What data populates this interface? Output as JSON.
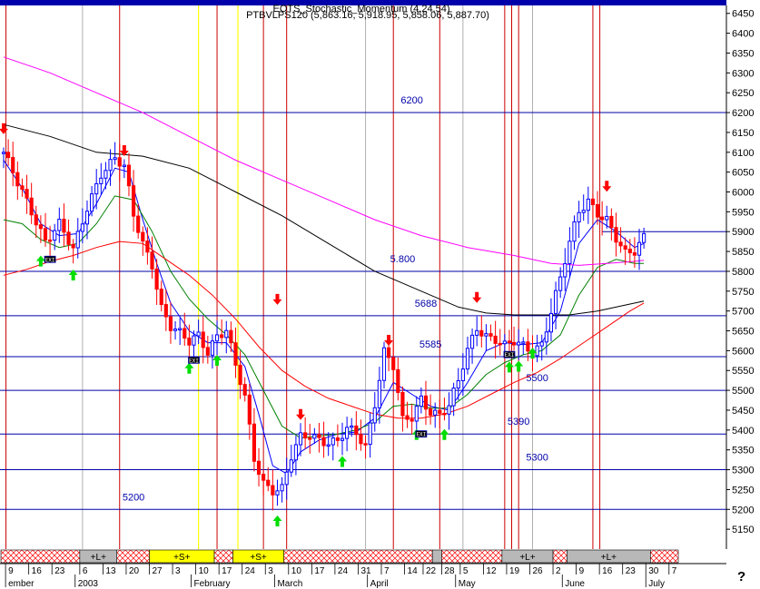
{
  "header": {
    "line1": "EOTS_Stochastic_Momentum (4,24,54)",
    "line2": "PTBVLPS120 (5,863.16, 5,918.95, 5,858.06, 5,887.70)"
  },
  "corner_mark": "?",
  "chart_data": {
    "type": "candlestick",
    "ylim": [
      5100,
      6470
    ],
    "yticks": [
      5150,
      5200,
      5250,
      5300,
      5350,
      5400,
      5450,
      5500,
      5550,
      5600,
      5650,
      5700,
      5750,
      5800,
      5850,
      5900,
      5950,
      6000,
      6050,
      6100,
      6150,
      6200,
      6250,
      6300,
      6350,
      6400,
      6450
    ],
    "grid": false,
    "xlim_sessions": [
      0,
      155
    ],
    "day_ticks": [
      {
        "s": 1,
        "label": "9"
      },
      {
        "s": 6,
        "label": "16"
      },
      {
        "s": 11,
        "label": "23"
      },
      {
        "s": 17,
        "label": "6"
      },
      {
        "s": 22,
        "label": "13"
      },
      {
        "s": 27,
        "label": "20"
      },
      {
        "s": 32,
        "label": "27"
      },
      {
        "s": 37,
        "label": "3"
      },
      {
        "s": 42,
        "label": "10"
      },
      {
        "s": 47,
        "label": "17"
      },
      {
        "s": 52,
        "label": "24"
      },
      {
        "s": 57,
        "label": "3"
      },
      {
        "s": 62,
        "label": "10"
      },
      {
        "s": 67,
        "label": "17"
      },
      {
        "s": 72,
        "label": "24"
      },
      {
        "s": 77,
        "label": "31"
      },
      {
        "s": 82,
        "label": "7"
      },
      {
        "s": 87,
        "label": "14"
      },
      {
        "s": 91,
        "label": "22"
      },
      {
        "s": 95,
        "label": "28"
      },
      {
        "s": 99,
        "label": "5"
      },
      {
        "s": 104,
        "label": "12"
      },
      {
        "s": 109,
        "label": "19"
      },
      {
        "s": 114,
        "label": "26"
      },
      {
        "s": 119,
        "label": "2"
      },
      {
        "s": 124,
        "label": "9"
      },
      {
        "s": 129,
        "label": "16"
      },
      {
        "s": 134,
        "label": "23"
      },
      {
        "s": 139,
        "label": "30"
      },
      {
        "s": 144,
        "label": "7"
      }
    ],
    "month_labels": [
      {
        "s": 1,
        "label": "ember"
      },
      {
        "s": 16,
        "label": "2003"
      },
      {
        "s": 41,
        "label": "February"
      },
      {
        "s": 59,
        "label": "March"
      },
      {
        "s": 79,
        "label": "April"
      },
      {
        "s": 98,
        "label": "May"
      },
      {
        "s": 121,
        "label": "June"
      },
      {
        "s": 139,
        "label": "July"
      }
    ],
    "level_lines": [
      {
        "value": 6200,
        "label": "6200",
        "label_s": 88
      },
      {
        "value": 5800,
        "label": "5.800",
        "label_s": 86
      },
      {
        "value": 5688,
        "label": "5688",
        "label_s": 91
      },
      {
        "value": 5585,
        "label": "5585",
        "label_s": 92
      },
      {
        "value": 5500,
        "label": "5500",
        "label_s": 115
      },
      {
        "value": 5390,
        "label": "5390",
        "label_s": 111
      },
      {
        "value": 5300,
        "label": "5300",
        "label_s": 115
      },
      {
        "value": 5200,
        "label": "5200",
        "label_s": 28
      },
      {
        "value": 5900,
        "label": "",
        "label_s": null,
        "from_s": 129
      }
    ],
    "red_vlines": [
      0.5,
      25,
      46,
      56,
      61,
      84,
      94,
      108,
      109.5,
      111,
      127,
      128.5
    ],
    "yellow_vlines": [
      42,
      50.5
    ],
    "gray_vlines": [
      17,
      78,
      99,
      114
    ],
    "signal_bands": [
      {
        "from": 0,
        "to": 17,
        "label": "",
        "kind": "hatch"
      },
      {
        "from": 17,
        "to": 25,
        "label": "+L+",
        "kind": "gray"
      },
      {
        "from": 25,
        "to": 32,
        "label": "",
        "kind": "hatch"
      },
      {
        "from": 32,
        "to": 46,
        "label": "+S+",
        "kind": "yellow"
      },
      {
        "from": 46,
        "to": 50,
        "label": "",
        "kind": "hatch"
      },
      {
        "from": 50,
        "to": 61,
        "label": "+S+",
        "kind": "yellow"
      },
      {
        "from": 61,
        "to": 93,
        "label": "",
        "kind": "hatch"
      },
      {
        "from": 93,
        "to": 95,
        "label": "",
        "kind": "gray"
      },
      {
        "from": 95,
        "to": 108,
        "label": "",
        "kind": "hatch"
      },
      {
        "from": 108,
        "to": 119,
        "label": "+L+",
        "kind": "gray"
      },
      {
        "from": 119,
        "to": 122,
        "label": "",
        "kind": "hatch"
      },
      {
        "from": 122,
        "to": 140,
        "label": "+L+",
        "kind": "gray"
      },
      {
        "from": 140,
        "to": 146,
        "label": "",
        "kind": "hatch"
      }
    ],
    "down_arrows": [
      {
        "s": 0,
        "value": 6150
      },
      {
        "s": 26,
        "value": 6095
      },
      {
        "s": 59,
        "value": 5720
      },
      {
        "s": 64,
        "value": 5430
      },
      {
        "s": 83,
        "value": 5617
      },
      {
        "s": 102,
        "value": 5725
      },
      {
        "s": 130,
        "value": 6005
      }
    ],
    "up_arrows": [
      {
        "s": 8,
        "value": 5835
      },
      {
        "s": 15,
        "value": 5800
      },
      {
        "s": 40,
        "value": 5565
      },
      {
        "s": 46,
        "value": 5585
      },
      {
        "s": 59,
        "value": 5180
      },
      {
        "s": 73,
        "value": 5330
      },
      {
        "s": 89,
        "value": 5398
      },
      {
        "s": 95,
        "value": 5398
      },
      {
        "s": 109,
        "value": 5568
      },
      {
        "s": 111,
        "value": 5570
      },
      {
        "s": 114,
        "value": 5603
      }
    ],
    "markers": [
      {
        "s": 10,
        "value": 5829,
        "label": "EXI"
      },
      {
        "s": 41,
        "value": 5575,
        "label": "EXI"
      },
      {
        "s": 90,
        "value": 5389,
        "label": "EXI"
      },
      {
        "s": 109,
        "value": 5589,
        "label": "EXI"
      }
    ],
    "series": [
      {
        "role": "price",
        "color": "#0000ff",
        "down_color": "#ff0000",
        "ohlc_by_anchor": [
          [
            0,
            6100
          ],
          [
            3,
            6020
          ],
          [
            6,
            5950
          ],
          [
            9,
            5880
          ],
          [
            12,
            5920
          ],
          [
            15,
            5850
          ],
          [
            18,
            5960
          ],
          [
            21,
            6050
          ],
          [
            24,
            6085
          ],
          [
            26,
            6060
          ],
          [
            28,
            5940
          ],
          [
            30,
            5870
          ],
          [
            32,
            5820
          ],
          [
            34,
            5710
          ],
          [
            36,
            5660
          ],
          [
            38,
            5640
          ],
          [
            40,
            5620
          ],
          [
            42,
            5640
          ],
          [
            44,
            5600
          ],
          [
            46,
            5640
          ],
          [
            48,
            5650
          ],
          [
            50,
            5560
          ],
          [
            52,
            5480
          ],
          [
            54,
            5330
          ],
          [
            56,
            5270
          ],
          [
            58,
            5250
          ],
          [
            60,
            5250
          ],
          [
            62,
            5330
          ],
          [
            64,
            5380
          ],
          [
            66,
            5390
          ],
          [
            68,
            5380
          ],
          [
            70,
            5370
          ],
          [
            72,
            5370
          ],
          [
            74,
            5400
          ],
          [
            76,
            5390
          ],
          [
            78,
            5360
          ],
          [
            80,
            5470
          ],
          [
            82,
            5600
          ],
          [
            84,
            5560
          ],
          [
            86,
            5420
          ],
          [
            88,
            5430
          ],
          [
            90,
            5480
          ],
          [
            92,
            5450
          ],
          [
            94,
            5440
          ],
          [
            96,
            5460
          ],
          [
            98,
            5520
          ],
          [
            100,
            5600
          ],
          [
            102,
            5660
          ],
          [
            104,
            5640
          ],
          [
            106,
            5630
          ],
          [
            108,
            5610
          ],
          [
            110,
            5620
          ],
          [
            112,
            5610
          ],
          [
            114,
            5600
          ],
          [
            116,
            5620
          ],
          [
            118,
            5700
          ],
          [
            120,
            5780
          ],
          [
            122,
            5870
          ],
          [
            124,
            5950
          ],
          [
            126,
            5980
          ],
          [
            128,
            5950
          ],
          [
            130,
            5930
          ],
          [
            132,
            5880
          ],
          [
            134,
            5840
          ],
          [
            136,
            5850
          ],
          [
            138,
            5890
          ]
        ]
      },
      {
        "role": "ma-fast",
        "color": "#0000ff",
        "values": [
          [
            0,
            6080
          ],
          [
            4,
            6010
          ],
          [
            8,
            5920
          ],
          [
            12,
            5890
          ],
          [
            16,
            5895
          ],
          [
            20,
            5970
          ],
          [
            24,
            6060
          ],
          [
            27,
            6050
          ],
          [
            30,
            5930
          ],
          [
            33,
            5820
          ],
          [
            36,
            5720
          ],
          [
            40,
            5650
          ],
          [
            44,
            5620
          ],
          [
            48,
            5620
          ],
          [
            52,
            5560
          ],
          [
            55,
            5440
          ],
          [
            58,
            5310
          ],
          [
            61,
            5290
          ],
          [
            64,
            5345
          ],
          [
            68,
            5375
          ],
          [
            72,
            5390
          ],
          [
            76,
            5395
          ],
          [
            80,
            5430
          ],
          [
            84,
            5520
          ],
          [
            88,
            5490
          ],
          [
            92,
            5460
          ],
          [
            96,
            5450
          ],
          [
            100,
            5520
          ],
          [
            104,
            5600
          ],
          [
            108,
            5620
          ],
          [
            112,
            5615
          ],
          [
            116,
            5620
          ],
          [
            120,
            5700
          ],
          [
            124,
            5870
          ],
          [
            128,
            5930
          ],
          [
            132,
            5900
          ],
          [
            136,
            5860
          ],
          [
            138,
            5870
          ]
        ]
      },
      {
        "role": "ma-mid",
        "color": "#008000",
        "values": [
          [
            0,
            5930
          ],
          [
            4,
            5920
          ],
          [
            8,
            5880
          ],
          [
            12,
            5860
          ],
          [
            16,
            5870
          ],
          [
            20,
            5920
          ],
          [
            24,
            5990
          ],
          [
            28,
            5980
          ],
          [
            32,
            5900
          ],
          [
            36,
            5800
          ],
          [
            40,
            5730
          ],
          [
            44,
            5680
          ],
          [
            48,
            5640
          ],
          [
            52,
            5590
          ],
          [
            56,
            5500
          ],
          [
            60,
            5410
          ],
          [
            64,
            5380
          ],
          [
            68,
            5385
          ],
          [
            72,
            5390
          ],
          [
            76,
            5400
          ],
          [
            80,
            5420
          ],
          [
            84,
            5460
          ],
          [
            88,
            5465
          ],
          [
            92,
            5455
          ],
          [
            96,
            5455
          ],
          [
            100,
            5490
          ],
          [
            104,
            5540
          ],
          [
            108,
            5570
          ],
          [
            112,
            5590
          ],
          [
            116,
            5600
          ],
          [
            120,
            5640
          ],
          [
            124,
            5740
          ],
          [
            128,
            5810
          ],
          [
            132,
            5830
          ],
          [
            136,
            5820
          ],
          [
            138,
            5820
          ]
        ]
      },
      {
        "role": "ma-slow",
        "color": "#ff0000",
        "values": [
          [
            0,
            5790
          ],
          [
            5,
            5805
          ],
          [
            10,
            5825
          ],
          [
            15,
            5840
          ],
          [
            20,
            5860
          ],
          [
            25,
            5875
          ],
          [
            30,
            5870
          ],
          [
            35,
            5830
          ],
          [
            40,
            5790
          ],
          [
            45,
            5740
          ],
          [
            50,
            5680
          ],
          [
            55,
            5610
          ],
          [
            60,
            5550
          ],
          [
            65,
            5510
          ],
          [
            70,
            5480
          ],
          [
            75,
            5460
          ],
          [
            80,
            5440
          ],
          [
            85,
            5430
          ],
          [
            90,
            5430
          ],
          [
            95,
            5440
          ],
          [
            100,
            5460
          ],
          [
            105,
            5490
          ],
          [
            110,
            5520
          ],
          [
            115,
            5545
          ],
          [
            120,
            5580
          ],
          [
            125,
            5620
          ],
          [
            130,
            5660
          ],
          [
            135,
            5700
          ],
          [
            138,
            5720
          ]
        ]
      },
      {
        "role": "ma-long",
        "color": "#000000",
        "values": [
          [
            0,
            6170
          ],
          [
            10,
            6140
          ],
          [
            20,
            6100
          ],
          [
            30,
            6090
          ],
          [
            40,
            6060
          ],
          [
            50,
            6000
          ],
          [
            60,
            5940
          ],
          [
            70,
            5870
          ],
          [
            80,
            5800
          ],
          [
            90,
            5750
          ],
          [
            98,
            5710
          ],
          [
            104,
            5695
          ],
          [
            110,
            5690
          ],
          [
            116,
            5690
          ],
          [
            122,
            5690
          ],
          [
            128,
            5700
          ],
          [
            134,
            5715
          ],
          [
            138,
            5725
          ]
        ]
      },
      {
        "role": "ma-longest",
        "color": "#ff00ff",
        "values": [
          [
            0,
            6340
          ],
          [
            10,
            6300
          ],
          [
            20,
            6250
          ],
          [
            30,
            6200
          ],
          [
            40,
            6140
          ],
          [
            50,
            6080
          ],
          [
            60,
            6030
          ],
          [
            70,
            5980
          ],
          [
            80,
            5930
          ],
          [
            90,
            5890
          ],
          [
            100,
            5860
          ],
          [
            110,
            5840
          ],
          [
            118,
            5820
          ],
          [
            124,
            5815
          ],
          [
            130,
            5820
          ],
          [
            136,
            5825
          ],
          [
            138,
            5828
          ]
        ]
      }
    ]
  }
}
